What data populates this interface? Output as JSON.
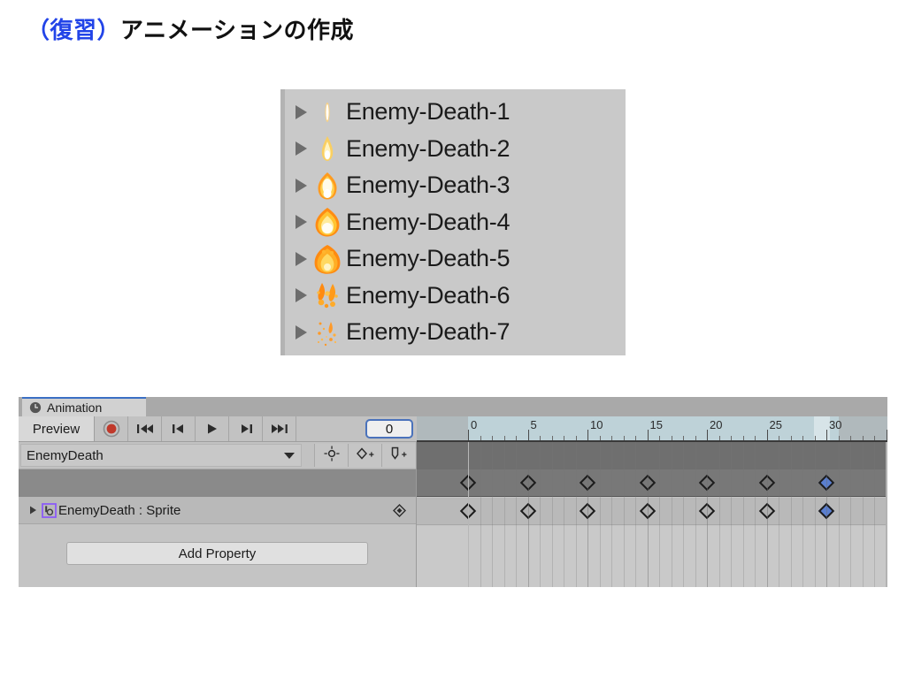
{
  "title": {
    "prefix": "（復習）",
    "main": "アニメーションの作成"
  },
  "sprite_list": {
    "items": [
      {
        "label": "Enemy-Death-1",
        "thumb": "explosion-flame-thin"
      },
      {
        "label": "Enemy-Death-2",
        "thumb": "explosion-flame-small"
      },
      {
        "label": "Enemy-Death-3",
        "thumb": "explosion-burst-bright"
      },
      {
        "label": "Enemy-Death-4",
        "thumb": "explosion-burst-full"
      },
      {
        "label": "Enemy-Death-5",
        "thumb": "explosion-expanding"
      },
      {
        "label": "Enemy-Death-6",
        "thumb": "explosion-breaking"
      },
      {
        "label": "Enemy-Death-7",
        "thumb": "explosion-particles"
      }
    ],
    "expand_icon": "triangle-right-icon",
    "background_color": "#c9c9c9"
  },
  "animation_window": {
    "tab": {
      "label": "Animation",
      "icon": "clock-icon",
      "active_border_color": "#3b6fc4"
    },
    "toolbar": {
      "preview_label": "Preview",
      "record_icon": "record-circle-icon",
      "record_color": "#c0392b",
      "transport": [
        {
          "name": "skip-to-start-button",
          "icon": "skip-start-icon"
        },
        {
          "name": "previous-keyframe-button",
          "icon": "step-back-icon"
        },
        {
          "name": "play-button",
          "icon": "play-icon"
        },
        {
          "name": "next-keyframe-button",
          "icon": "step-forward-icon"
        },
        {
          "name": "skip-to-end-button",
          "icon": "skip-end-icon"
        }
      ],
      "frame_field_value": "0",
      "frame_field_focus_color": "#4a72bb"
    },
    "clip_row": {
      "clip_name": "EnemyDeath",
      "dropdown_icon": "chevron-down-icon",
      "tools": [
        {
          "name": "filter-by-selection-button",
          "icon": "target-icon"
        },
        {
          "name": "add-keyframe-button",
          "icon": "diamond-plus-icon"
        },
        {
          "name": "add-event-button",
          "icon": "event-marker-plus-icon"
        }
      ]
    },
    "hierarchy": {
      "property_label": "EnemyDeath : Sprite",
      "property_icon": "animation-clip-icon",
      "property_icon_color": "#8b5cf6",
      "expand_icon": "triangle-right-icon",
      "property_keyframe_icon": "diamond-icon",
      "add_property_label": "Add Property"
    },
    "timeline": {
      "tick_labels": [
        "0",
        "5",
        "10",
        "15",
        "20",
        "25",
        "30"
      ],
      "tick_values": [
        0,
        5,
        10,
        15,
        20,
        25,
        30
      ],
      "minor_tick_interval": 1,
      "playhead_frame": 0,
      "range_end_frame": 30,
      "ruler_background": "#bed2d8",
      "keyframes": [
        0,
        5,
        10,
        15,
        20,
        25,
        30
      ],
      "selected_keyframes": [
        30
      ],
      "selected_color": "#5a7fd0"
    }
  }
}
